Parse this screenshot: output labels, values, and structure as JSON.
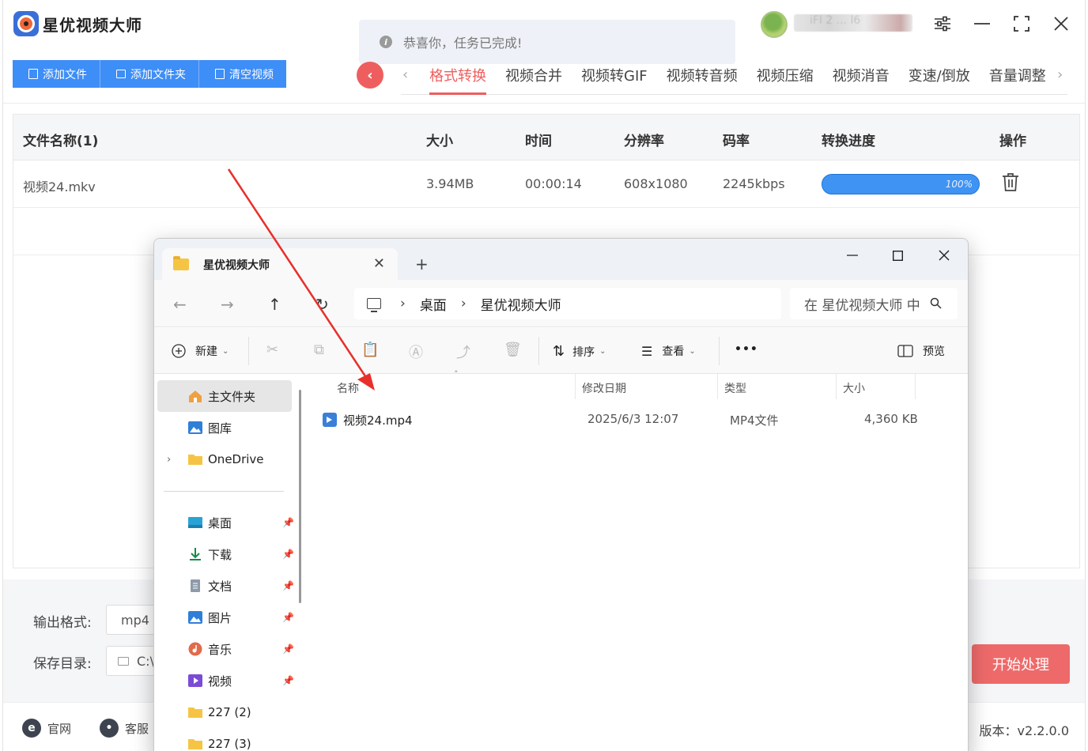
{
  "app": {
    "title": "星优视频大师",
    "toast": "恭喜你，任务已完成!",
    "user_name": "iFl 2  ... l6",
    "toolbar": {
      "add_file": "添加文件",
      "add_folder": "添加文件夹",
      "clear": "清空视频"
    },
    "tabs": [
      "格式转换",
      "视频合并",
      "视频转GIF",
      "视频转音频",
      "视频压缩",
      "视频消音",
      "变速/倒放",
      "音量调整"
    ],
    "active_tab": "格式转换",
    "table": {
      "headers": [
        "文件名称(1)",
        "大小",
        "时间",
        "分辨率",
        "码率",
        "转换进度",
        "操作"
      ],
      "rows": [
        {
          "name": "视频24.mkv",
          "size": "3.94MB",
          "duration": "00:00:14",
          "resolution": "608x1080",
          "bitrate": "2245kbps",
          "progress": 1.0,
          "progress_label": "100%"
        }
      ]
    },
    "output_format_label": "输出格式:",
    "output_format_value": "mp4",
    "save_dir_label": "保存目录:",
    "save_dir_value": "C:\\",
    "start_button": "开始处理",
    "footer": {
      "website": "官网",
      "support": "客服",
      "version": "版本：v2.2.0.0"
    },
    "colors": {
      "primary_blue": "#3e8ef7",
      "accent_red": "#ee5e5e",
      "progress_blue": "#2e8cf0"
    }
  },
  "explorer": {
    "tab_title": "星优视频大师",
    "breadcrumb": [
      "桌面",
      "星优视频大师"
    ],
    "search_placeholder": "在 星优视频大师 中",
    "commands": {
      "new": "新建",
      "sort": "排序",
      "view": "查看",
      "more": "•••",
      "preview": "预览"
    },
    "sidebar": {
      "top": [
        {
          "label": "主文件夹",
          "icon": "home-icon",
          "active": true
        },
        {
          "label": "图库",
          "icon": "gallery-icon"
        },
        {
          "label": "OneDrive",
          "icon": "folder-icon",
          "expandable": true
        }
      ],
      "pinned": [
        {
          "label": "桌面",
          "icon": "desktop-icon"
        },
        {
          "label": "下载",
          "icon": "download-icon"
        },
        {
          "label": "文档",
          "icon": "document-icon"
        },
        {
          "label": "图片",
          "icon": "pictures-icon"
        },
        {
          "label": "音乐",
          "icon": "music-icon"
        },
        {
          "label": "视频",
          "icon": "video-icon"
        }
      ],
      "folders": [
        {
          "label": "227 (2)",
          "icon": "folder-icon"
        },
        {
          "label": "227 (3)",
          "icon": "folder-icon"
        }
      ]
    },
    "columns": [
      "名称",
      "修改日期",
      "类型",
      "大小"
    ],
    "files": [
      {
        "name": "视频24.mp4",
        "modified": "2025/6/3 12:07",
        "type": "MP4文件",
        "size": "4,360 KB"
      }
    ]
  }
}
